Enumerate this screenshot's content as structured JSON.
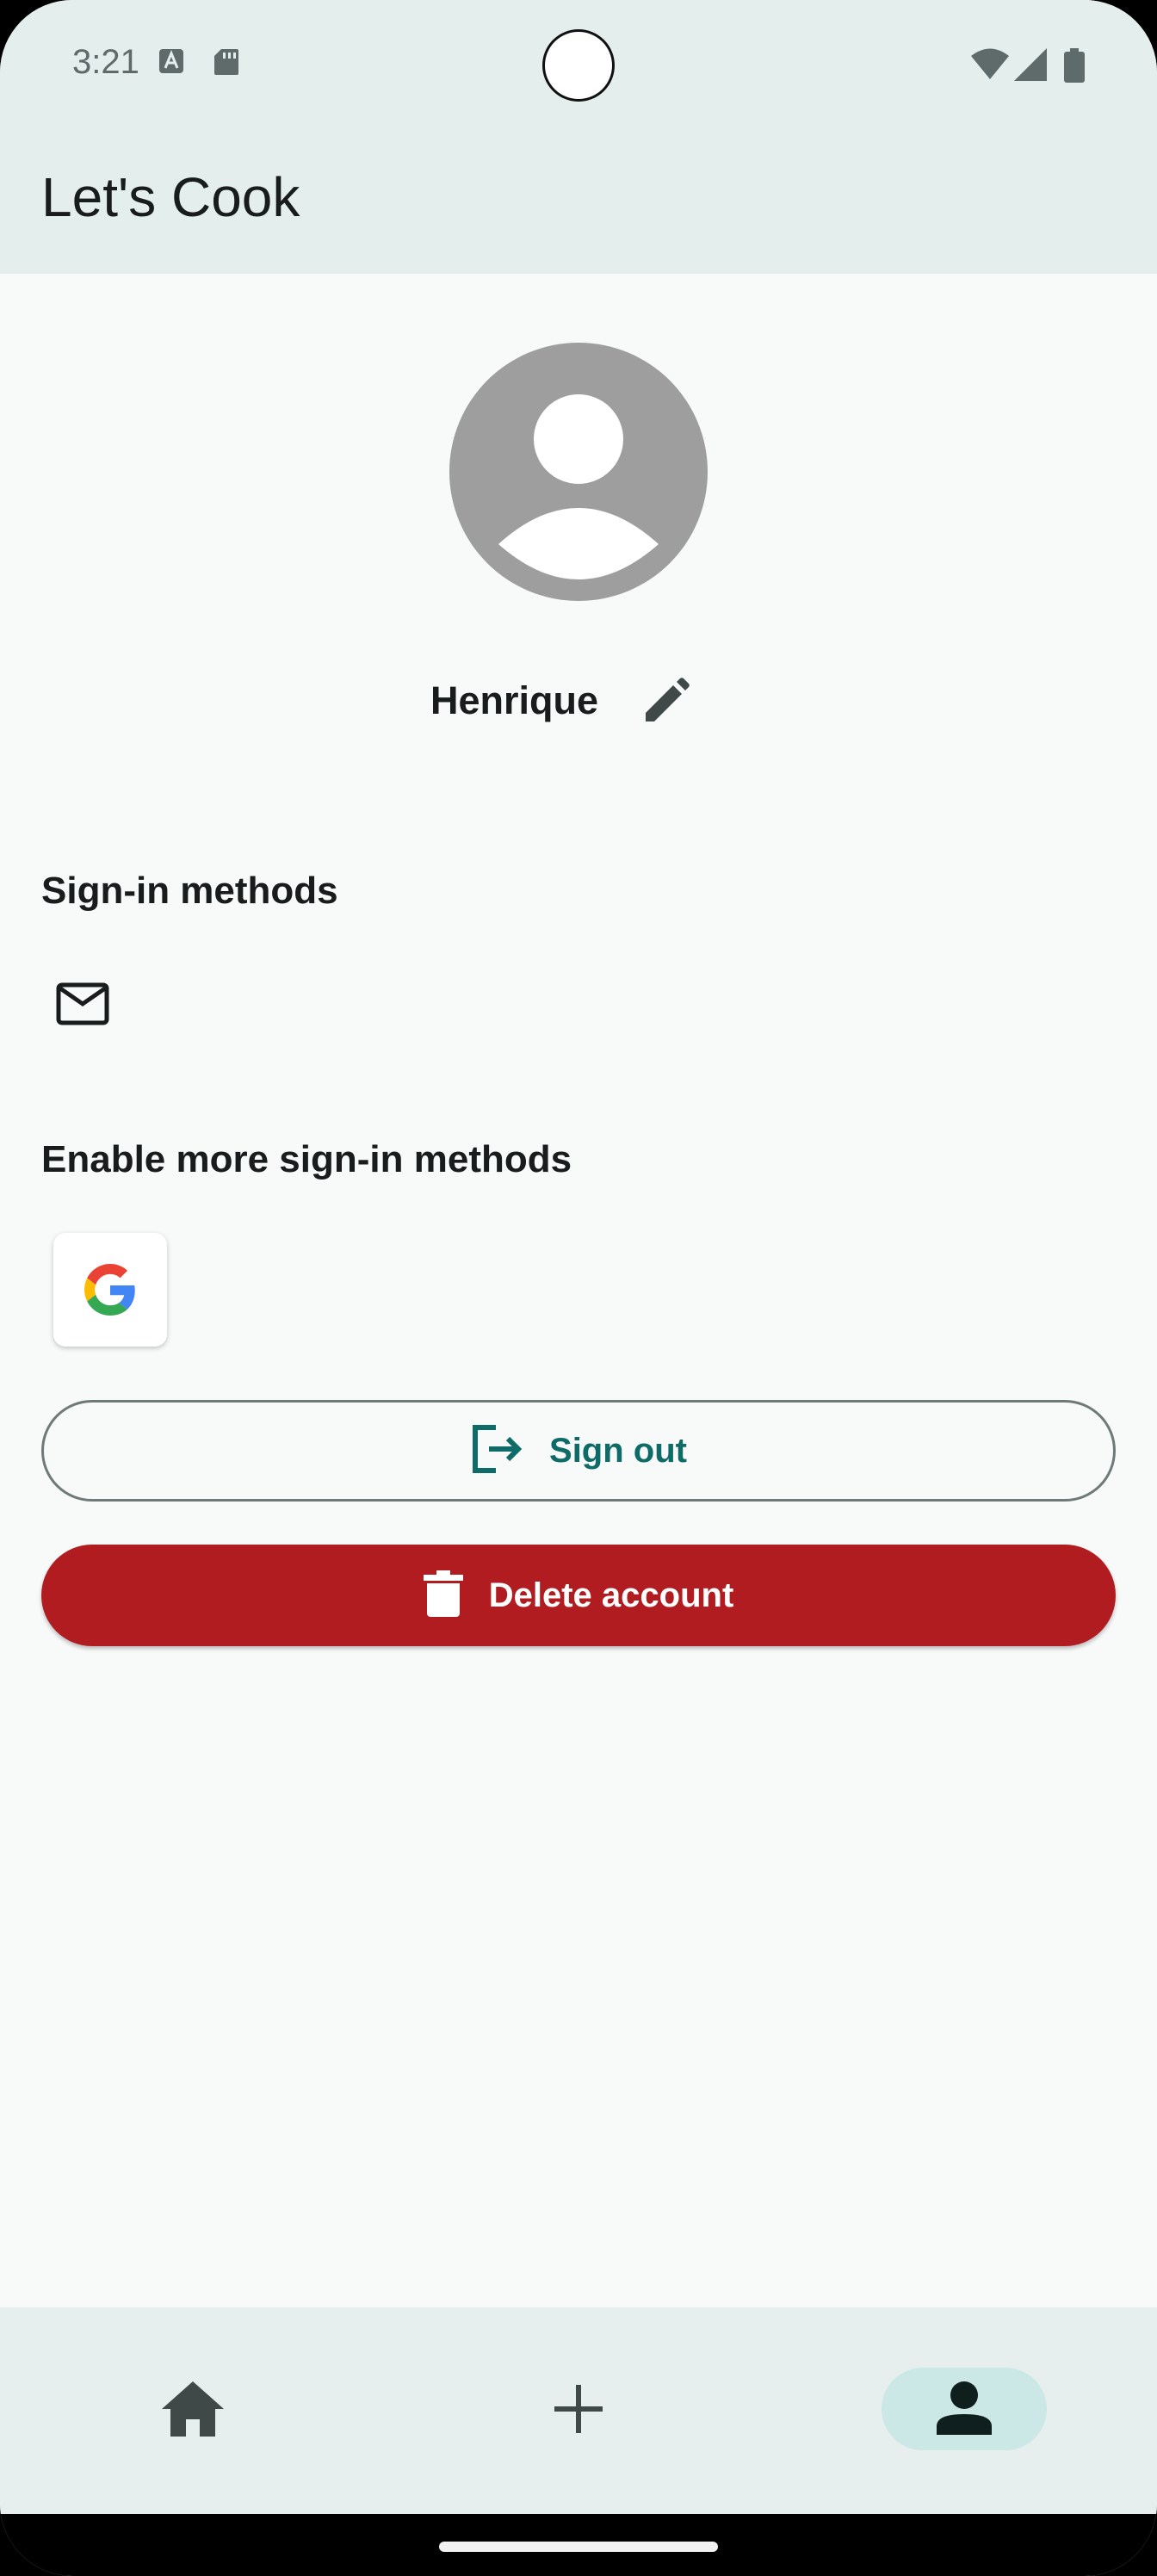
{
  "status_bar": {
    "time": "3:21",
    "icons": [
      "text-a-icon",
      "sd-card-icon",
      "wifi-icon",
      "signal-icon",
      "battery-icon"
    ]
  },
  "app_bar": {
    "title": "Let's Cook"
  },
  "profile": {
    "avatar_icon": "account-circle-icon",
    "username": "Henrique",
    "edit_icon": "pencil-icon"
  },
  "sign_in_methods": {
    "title": "Sign-in methods",
    "methods": [
      "email-icon"
    ]
  },
  "enable_more": {
    "title": "Enable more sign-in methods",
    "providers": [
      "google-icon"
    ]
  },
  "actions": {
    "sign_out_label": "Sign out",
    "delete_label": "Delete account"
  },
  "bottom_nav": {
    "items": [
      {
        "icon": "home-icon",
        "active": false
      },
      {
        "icon": "add-icon",
        "active": false
      },
      {
        "icon": "person-icon",
        "active": true
      }
    ]
  },
  "colors": {
    "app_bar_bg": "#e3eeed",
    "background": "#f8faf9",
    "primary": "#0e6b67",
    "danger": "#b11c20",
    "nav_active": "#cce8e6",
    "avatar": "#9e9e9e"
  }
}
